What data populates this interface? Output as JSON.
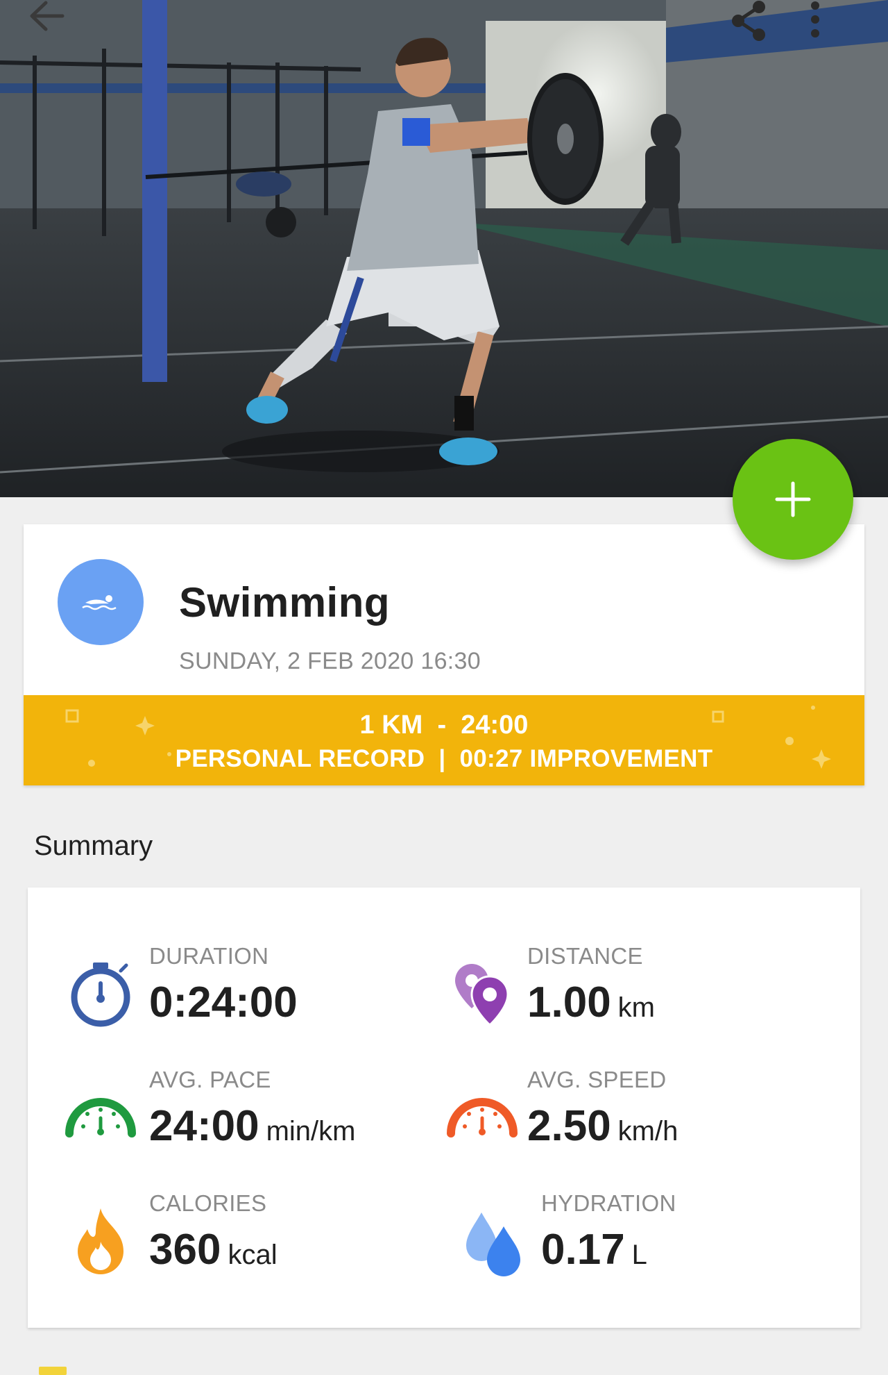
{
  "toolbar": {
    "back_icon": "arrow-left-icon",
    "share_icon": "share-icon",
    "more_icon": "more-vertical-icon"
  },
  "hero": {
    "image": "man lunging with weight plate in gym"
  },
  "fab": {
    "icon": "plus-icon",
    "color": "#6ac214"
  },
  "activity": {
    "sport_icon": "swimmer-icon",
    "sport_color": "#6aa1f3",
    "name": "Swimming",
    "date": "SUNDAY, 2 FEB 2020 16:30",
    "record": {
      "distance": "1 KM",
      "separator": "-",
      "time": "24:00",
      "label": "PERSONAL RECORD",
      "divider": "|",
      "improvement": "00:27 IMPROVEMENT",
      "color": "#f2b40b"
    }
  },
  "summary": {
    "title": "Summary",
    "metrics": [
      {
        "label": "DURATION",
        "value": "0:24:00",
        "unit": "",
        "icon": "stopwatch-icon",
        "color": "#3b5ea8"
      },
      {
        "label": "DISTANCE",
        "value": "1.00",
        "unit": "km",
        "icon": "map-pins-icon",
        "color": "#8e3fb0"
      },
      {
        "label": "AVG. PACE",
        "value": "24:00",
        "unit": "min/km",
        "icon": "speedometer-icon",
        "color": "#1f9a3f"
      },
      {
        "label": "AVG. SPEED",
        "value": "2.50",
        "unit": "km/h",
        "icon": "speedometer-icon",
        "color": "#ef5a27"
      },
      {
        "label": "CALORIES",
        "value": "360",
        "unit": "kcal",
        "icon": "flame-icon",
        "color": "#f7a020"
      },
      {
        "label": "HYDRATION",
        "value": "0.17",
        "unit": "L",
        "icon": "water-drops-icon",
        "color": "#4f8ef0"
      }
    ]
  }
}
